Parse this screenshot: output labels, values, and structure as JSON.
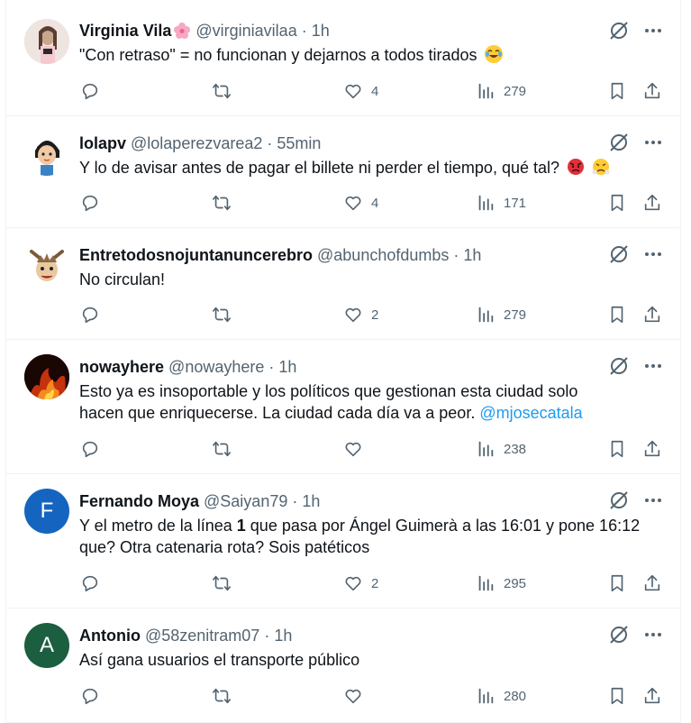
{
  "colors": {
    "text": "#0f1419",
    "muted": "#536471",
    "link": "#1d9bf0",
    "border": "#eff3f4"
  },
  "tweets": [
    {
      "name": "Virginia Vila",
      "name_emoji_icon": "cherry-blossom-icon",
      "handle": "@virginiavilaa",
      "sep": "·",
      "time": "1h",
      "text": "\"Con retraso\" = no funcionan y dejarnos a todos tirados",
      "text_emoji_icon": "tears-of-joy-emoji-icon",
      "likes": "4",
      "views": "279"
    },
    {
      "name": "lolapv",
      "handle": "@lolaperezvarea2",
      "sep": "·",
      "time": "55min",
      "text": "Y lo de avisar antes de pagar el billete ni perder el tiempo, qué tal?",
      "text_emoji_icons": [
        "angry-face-emoji-icon",
        "steam-nose-emoji-icon"
      ],
      "likes": "4",
      "views": "171"
    },
    {
      "name": "Entretodosnojuntanuncerebro",
      "handle": "@abunchofdumbs",
      "sep": "·",
      "time": "1h",
      "text": "No circulan!",
      "likes": "2",
      "views": "279"
    },
    {
      "name": "nowayhere",
      "handle": "@nowayhere",
      "sep": "·",
      "time": "1h",
      "text_line1": "Esto ya es insoportable y los políticos que gestionan esta ciudad solo",
      "text_line2": "hacen que enriquecerse. La ciudad cada día va a peor.",
      "mention": "@mjosecatala",
      "likes": "",
      "views": "238"
    },
    {
      "name": "Fernando Moya",
      "handle": "@Saiyan79",
      "sep": "·",
      "time": "1h",
      "avatar_initial": "F",
      "text_line1_a": "Y el metro de la línea ",
      "text_line1_bold": "1",
      "text_line1_b": " que pasa por Ángel Guimerà a las 16:01 y pone 16:12",
      "text_line2": "que? Otra catenaria rota? Sois patéticos",
      "likes": "2",
      "views": "295"
    },
    {
      "name": "Antonio",
      "handle": "@58zenitram07",
      "sep": "·",
      "time": "1h",
      "avatar_initial": "A",
      "text": "Así gana usuarios el transporte público",
      "likes": "",
      "views": "280"
    }
  ]
}
